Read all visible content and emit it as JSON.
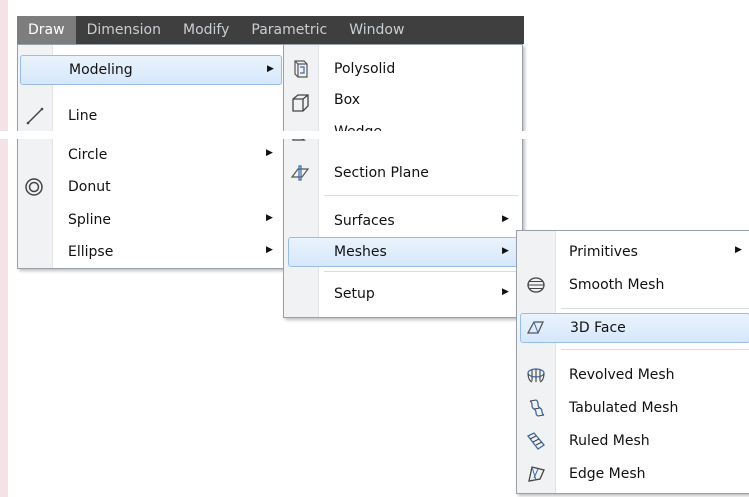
{
  "menubar": {
    "items": [
      "Draw",
      "Dimension",
      "Modify",
      "Parametric",
      "Window"
    ]
  },
  "draw_menu": {
    "items": [
      {
        "label": "Modeling",
        "submenu": true,
        "icon": ""
      },
      {
        "label": "Line",
        "submenu": false,
        "icon": "line-icon"
      },
      {
        "label": "Circle",
        "submenu": true,
        "icon": ""
      },
      {
        "label": "Donut",
        "submenu": false,
        "icon": "donut-icon"
      },
      {
        "label": "Spline",
        "submenu": true,
        "icon": ""
      },
      {
        "label": "Ellipse",
        "submenu": true,
        "icon": ""
      }
    ]
  },
  "modeling_menu": {
    "items": [
      {
        "label": "Polysolid",
        "submenu": false,
        "icon": "polysolid-icon"
      },
      {
        "label": "Box",
        "submenu": false,
        "icon": "box-icon"
      },
      {
        "label": "Wedge",
        "submenu": false,
        "icon": "wedge-icon"
      },
      {
        "label": "Section Plane",
        "submenu": false,
        "icon": "section-plane-icon"
      },
      {
        "label": "Surfaces",
        "submenu": true,
        "icon": ""
      },
      {
        "label": "Meshes",
        "submenu": true,
        "icon": ""
      },
      {
        "label": "Setup",
        "submenu": true,
        "icon": ""
      }
    ]
  },
  "meshes_menu": {
    "items": [
      {
        "label": "Primitives",
        "submenu": true,
        "icon": ""
      },
      {
        "label": "Smooth Mesh",
        "submenu": false,
        "icon": "smooth-mesh-icon"
      },
      {
        "label": "3D Face",
        "submenu": false,
        "icon": "3d-face-icon"
      },
      {
        "label": "Revolved Mesh",
        "submenu": false,
        "icon": "revolved-mesh-icon"
      },
      {
        "label": "Tabulated Mesh",
        "submenu": false,
        "icon": "tabulated-mesh-icon"
      },
      {
        "label": "Ruled Mesh",
        "submenu": false,
        "icon": "ruled-mesh-icon"
      },
      {
        "label": "Edge Mesh",
        "submenu": false,
        "icon": "edge-mesh-icon"
      }
    ]
  },
  "colors": {
    "menubar_bg": "#3f3f3f",
    "menubar_active": "#7d7d7d",
    "highlight_border": "#99bde6",
    "icon_blue": "#3a6aa8"
  }
}
